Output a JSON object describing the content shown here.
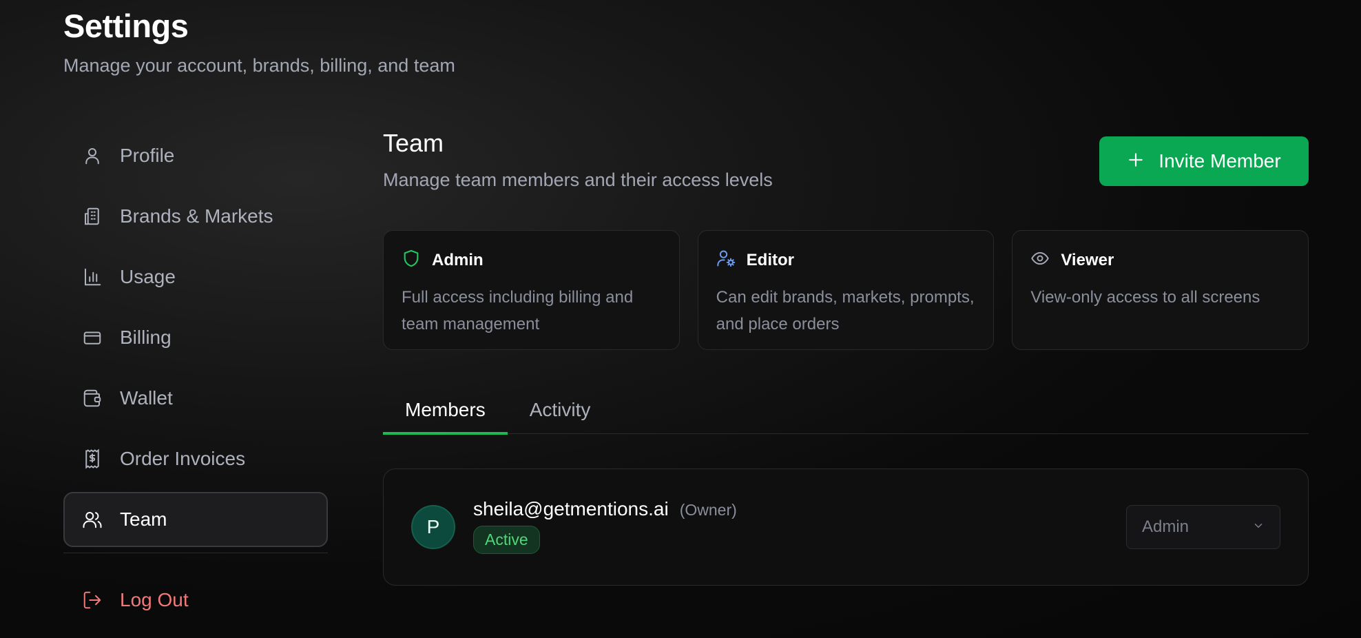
{
  "header": {
    "title": "Settings",
    "subtitle": "Manage your account, brands, billing, and team"
  },
  "sidebar": {
    "items": [
      {
        "label": "Profile",
        "icon": "user-icon"
      },
      {
        "label": "Brands & Markets",
        "icon": "building-icon"
      },
      {
        "label": "Usage",
        "icon": "bar-chart-icon"
      },
      {
        "label": "Billing",
        "icon": "credit-card-icon"
      },
      {
        "label": "Wallet",
        "icon": "wallet-icon"
      },
      {
        "label": "Order Invoices",
        "icon": "receipt-icon"
      },
      {
        "label": "Team",
        "icon": "users-icon",
        "active": true
      }
    ],
    "logout_label": "Log Out"
  },
  "team": {
    "title": "Team",
    "subtitle": "Manage team members and their access levels",
    "invite_label": "Invite Member"
  },
  "roles": [
    {
      "name": "Admin",
      "desc": "Full access including billing and team management",
      "icon": "shield-icon",
      "color": "#22c55e"
    },
    {
      "name": "Editor",
      "desc": "Can edit brands, markets, prompts, and place orders",
      "icon": "user-cog-icon",
      "color": "#6b9cf0"
    },
    {
      "name": "Viewer",
      "desc": "View-only access to all screens",
      "icon": "eye-icon",
      "color": "#a3a7b4"
    }
  ],
  "tabs": [
    {
      "label": "Members",
      "active": true
    },
    {
      "label": "Activity",
      "active": false
    }
  ],
  "members": [
    {
      "initial": "P",
      "email": "sheila@getmentions.ai",
      "tag": "(Owner)",
      "status": "Active",
      "role": "Admin"
    }
  ],
  "colors": {
    "accent": "#0aa853",
    "logout": "#f07a7a",
    "active_badge": "#4ed879"
  }
}
